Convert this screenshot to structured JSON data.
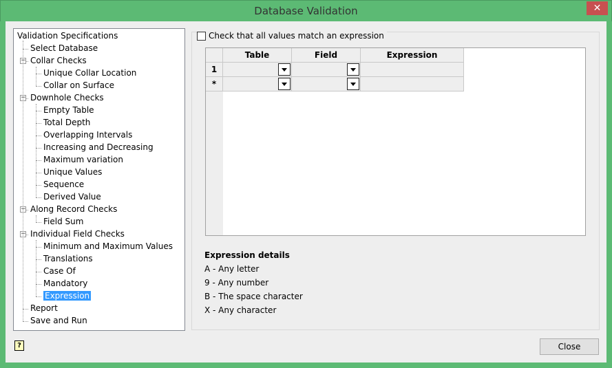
{
  "window": {
    "title": "Database Validation",
    "close_glyph": "✕"
  },
  "tree": {
    "root": "Validation Specifications",
    "items": [
      {
        "label": "Select Database",
        "level": 1
      },
      {
        "label": "Collar Checks",
        "level": 1,
        "expanded": true
      },
      {
        "label": "Unique Collar Location",
        "level": 2
      },
      {
        "label": "Collar on Surface",
        "level": 2
      },
      {
        "label": "Downhole Checks",
        "level": 1,
        "expanded": true
      },
      {
        "label": "Empty Table",
        "level": 2
      },
      {
        "label": "Total Depth",
        "level": 2
      },
      {
        "label": "Overlapping Intervals",
        "level": 2
      },
      {
        "label": "Increasing and Decreasing",
        "level": 2
      },
      {
        "label": "Maximum variation",
        "level": 2
      },
      {
        "label": "Unique Values",
        "level": 2
      },
      {
        "label": "Sequence",
        "level": 2
      },
      {
        "label": "Derived Value",
        "level": 2
      },
      {
        "label": "Along Record Checks",
        "level": 1,
        "expanded": true
      },
      {
        "label": "Field Sum",
        "level": 2
      },
      {
        "label": "Individual Field Checks",
        "level": 1,
        "expanded": true
      },
      {
        "label": "Minimum and Maximum Values",
        "level": 2
      },
      {
        "label": "Translations",
        "level": 2
      },
      {
        "label": "Case Of",
        "level": 2
      },
      {
        "label": "Mandatory",
        "level": 2
      },
      {
        "label": "Expression",
        "level": 2,
        "selected": true
      },
      {
        "label": "Report",
        "level": 1
      },
      {
        "label": "Save and Run",
        "level": 1
      }
    ]
  },
  "expression_check": {
    "label": "Check that all values match an expression",
    "checked": false
  },
  "grid": {
    "columns": [
      "Table",
      "Field",
      "Expression"
    ],
    "rows": [
      {
        "header": "1"
      },
      {
        "header": "*"
      }
    ]
  },
  "details": {
    "title": "Expression details",
    "lines": [
      "A - Any letter",
      "9 - Any number",
      "B - The space character",
      "X - Any character"
    ]
  },
  "buttons": {
    "help": "?",
    "close": "Close"
  }
}
